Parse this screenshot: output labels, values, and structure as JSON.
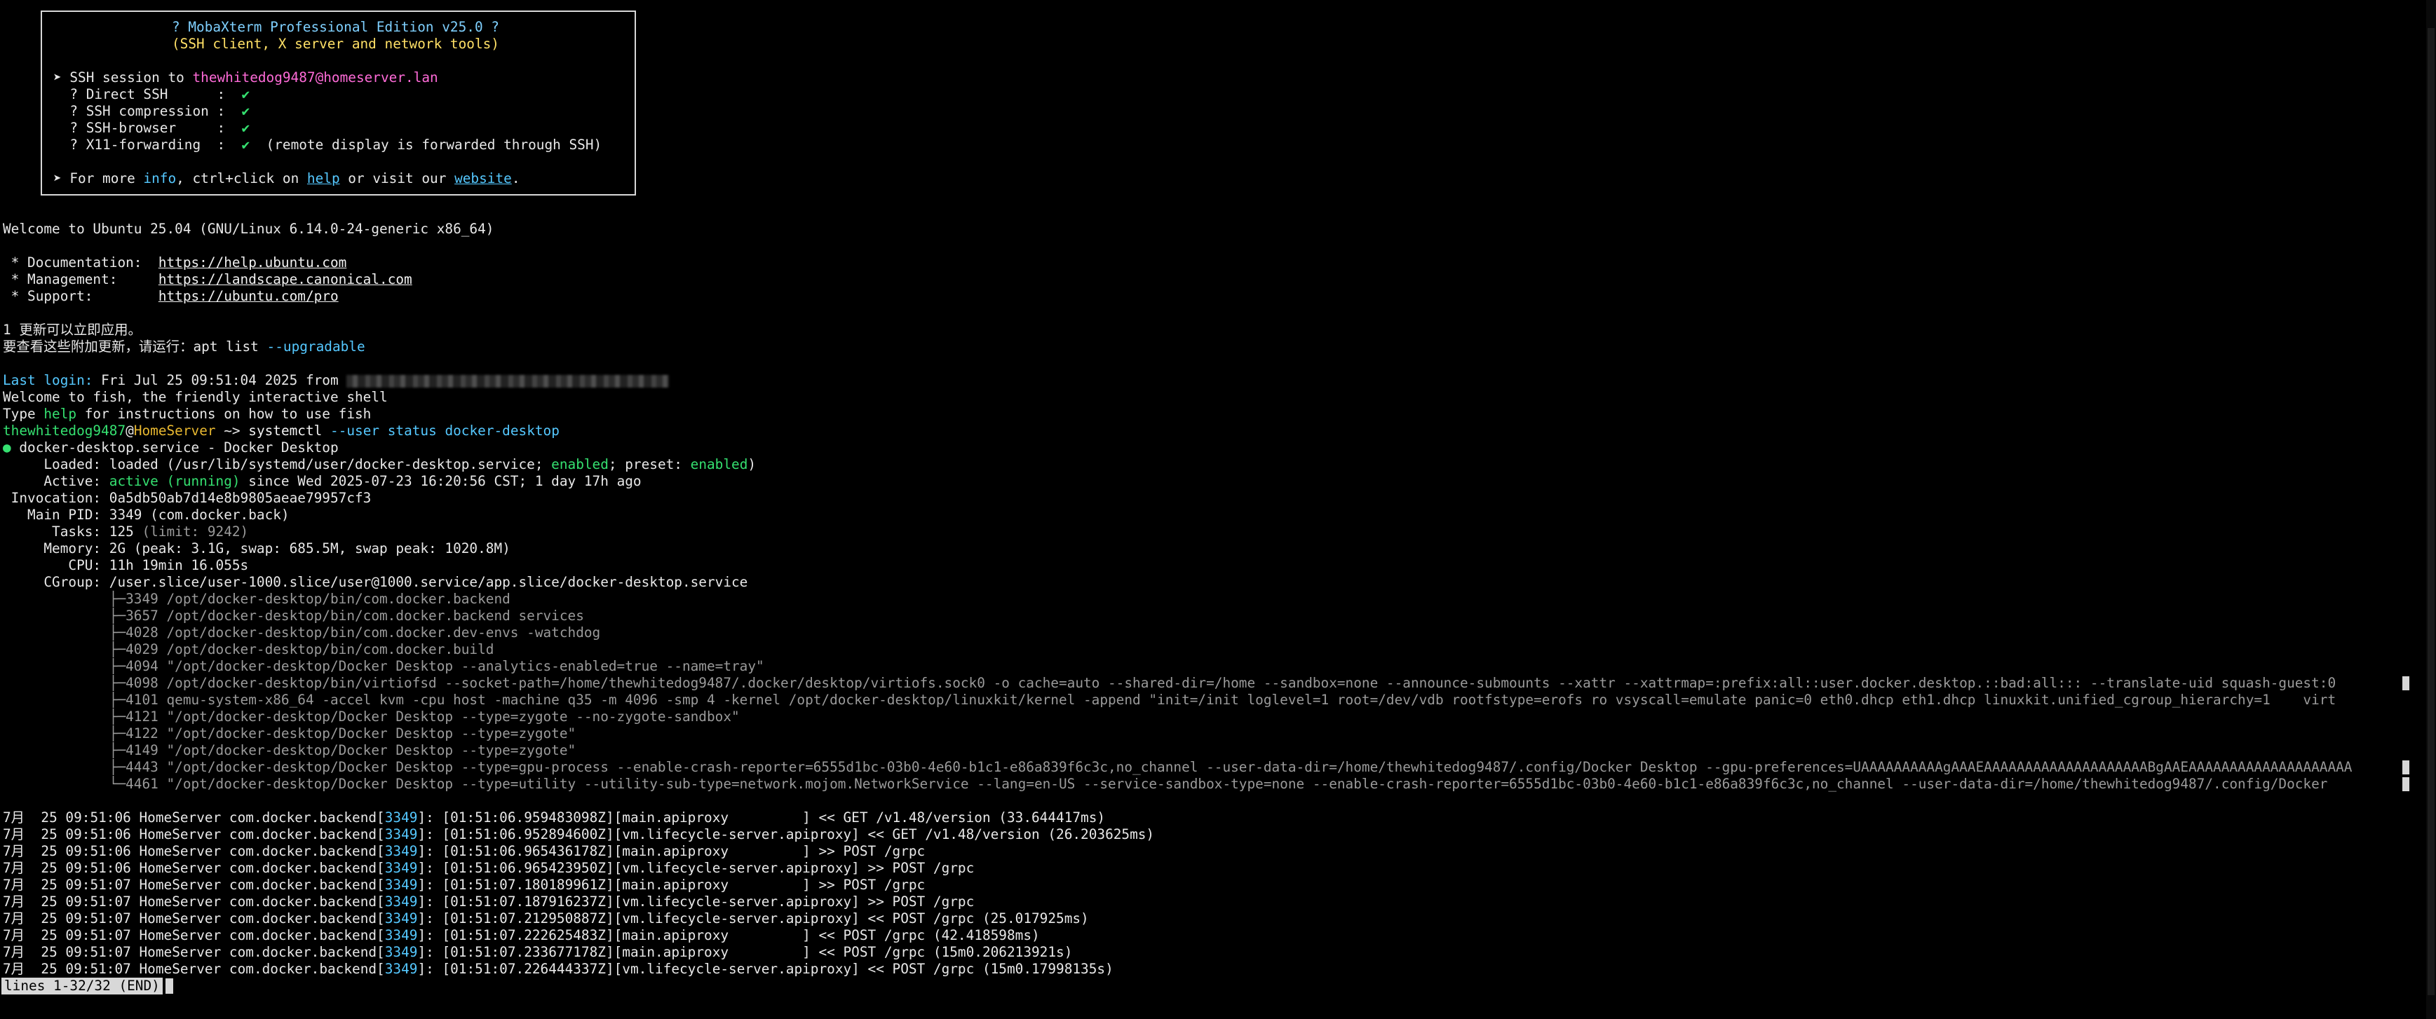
{
  "banner": {
    "title": "? MobaXterm Professional Edition v25.0 ?",
    "subtitle": "(SSH client, X server and network tools)",
    "ssh_prefix": "➤ SSH session to ",
    "ssh_target": "thewhitedog9487@homeserver.lan",
    "features": [
      {
        "label": "  ? Direct SSH      :  ",
        "check": "✔",
        "note": ""
      },
      {
        "label": "  ? SSH compression :  ",
        "check": "✔",
        "note": ""
      },
      {
        "label": "  ? SSH-browser     :  ",
        "check": "✔",
        "note": ""
      },
      {
        "label": "  ? X11-forwarding  :  ",
        "check": "✔",
        "note": "  (remote display is forwarded through SSH)"
      }
    ],
    "more_prefix": "➤ For more ",
    "info_word": "info",
    "more_mid": ", ctrl+click on ",
    "help_link": "help",
    "more_or": " or visit our ",
    "website_link": "website",
    "more_end": "."
  },
  "motd": {
    "welcome": "Welcome to Ubuntu 25.04 (GNU/Linux 6.14.0-24-generic x86_64)",
    "links": [
      {
        "label": " * Documentation:  ",
        "url": "https://help.ubuntu.com"
      },
      {
        "label": " * Management:     ",
        "url": "https://landscape.canonical.com"
      },
      {
        "label": " * Support:        ",
        "url": "https://ubuntu.com/pro"
      }
    ],
    "updates_line": "1 更新可以立即应用。",
    "updates_hint_prefix": "要查看这些附加更新，请运行：apt list ",
    "updates_hint_flag": "--upgradable",
    "last_login_label": "Last login:",
    "last_login_value": " Fri Jul 25 09:51:04 2025 from ",
    "fish_welcome": "Welcome to fish, the friendly interactive shell",
    "fish_help_prefix": "Type ",
    "fish_help_word": "help",
    "fish_help_suffix": " for instructions on how to use fish"
  },
  "prompt": {
    "user": "thewhitedog9487",
    "at": "@",
    "host": "HomeServer",
    "path": " ~> ",
    "command": "systemctl",
    "args": " --user status docker-desktop"
  },
  "status": {
    "bullet": "●",
    "unit_line": " docker-desktop.service - Docker Desktop",
    "loaded_label": "     Loaded: ",
    "loaded_value_a": "loaded (/usr/lib/systemd/user/docker-desktop.service; ",
    "loaded_enabled": "enabled",
    "loaded_value_b": "; preset: ",
    "loaded_preset": "enabled",
    "loaded_close": ")",
    "active_label": "     Active: ",
    "active_value": "active (running)",
    "active_rest": " since Wed 2025-07-23 16:20:56 CST; 1 day 17h ago",
    "invocation_label": " Invocation: ",
    "invocation_value": "0a5db50ab7d14e8b9805aeae79957cf3",
    "mainpid_label": "   Main PID: ",
    "mainpid_value": "3349 (com.docker.back)",
    "tasks_label": "      Tasks: ",
    "tasks_value": "125",
    "tasks_limit": " (limit: 9242)",
    "memory_label": "     Memory: ",
    "memory_value": "2G (peak: 3.1G, swap: 685.5M, swap peak: 1020.8M)",
    "cpu_label": "        CPU: ",
    "cpu_value": "11h 19min 16.055s",
    "cgroup_label": "     CGroup: ",
    "cgroup_value": "/user.slice/user-1000.slice/user@1000.service/app.slice/docker-desktop.service",
    "processes": [
      "             ├─3349 /opt/docker-desktop/bin/com.docker.backend",
      "             ├─3657 /opt/docker-desktop/bin/com.docker.backend services",
      "             ├─4028 /opt/docker-desktop/bin/com.docker.dev-envs -watchdog",
      "             ├─4029 /opt/docker-desktop/bin/com.docker.build",
      "             ├─4094 \"/opt/docker-desktop/Docker Desktop --analytics-enabled=true --name=tray\"",
      "             ├─4098 /opt/docker-desktop/bin/virtiofsd --socket-path=/home/thewhitedog9487/.docker/desktop/virtiofs.sock0 -o cache=auto --shared-dir=/home --sandbox=none --announce-submounts --xattr --xattrmap=:prefix:all::user.docker.desktop.::bad:all::: --translate-uid squash-guest:0",
      "             ├─4101 qemu-system-x86_64 -accel kvm -cpu host -machine q35 -m 4096 -smp 4 -kernel /opt/docker-desktop/linuxkit/kernel -append \"init=/init loglevel=1 root=/dev/vdb rootfstype=erofs ro vsyscall=emulate panic=0 eth0.dhcp eth1.dhcp linuxkit.unified_cgroup_hierarchy=1    virt",
      "             ├─4121 \"/opt/docker-desktop/Docker Desktop --type=zygote --no-zygote-sandbox\"",
      "             ├─4122 \"/opt/docker-desktop/Docker Desktop --type=zygote\"",
      "             ├─4149 \"/opt/docker-desktop/Docker Desktop --type=zygote\"",
      "             ├─4443 \"/opt/docker-desktop/Docker Desktop --type=gpu-process --enable-crash-reporter=6555d1bc-03b0-4e60-b1c1-e86a839f6c3c,no_channel --user-data-dir=/home/thewhitedog9487/.config/Docker Desktop --gpu-preferences=UAAAAAAAAAAgAAAEAAAAAAAAAAAAAAAAAAAABgAAEAAAAAAAAAAAAAAAAAAAA",
      "             └─4461 \"/opt/docker-desktop/Docker Desktop --type=utility --utility-sub-type=network.mojom.NetworkService --lang=en-US --service-sandbox-type=none --enable-crash-reporter=6555d1bc-03b0-4e60-b1c1-e86a839f6c3c,no_channel --user-data-dir=/home/thewhitedog9487/.config/Docker"
    ]
  },
  "log": {
    "entries": [
      {
        "prefix": "7月  25 09:51:06 HomeServer com.docker.backend[",
        "pid": "3349",
        "msg": "]: [01:51:06.959483098Z][main.apiproxy         ] << GET /v1.48/version (33.644417ms)"
      },
      {
        "prefix": "7月  25 09:51:06 HomeServer com.docker.backend[",
        "pid": "3349",
        "msg": "]: [01:51:06.952894600Z][vm.lifecycle-server.apiproxy] << GET /v1.48/version (26.203625ms)"
      },
      {
        "prefix": "7月  25 09:51:06 HomeServer com.docker.backend[",
        "pid": "3349",
        "msg": "]: [01:51:06.965436178Z][main.apiproxy         ] >> POST /grpc"
      },
      {
        "prefix": "7月  25 09:51:06 HomeServer com.docker.backend[",
        "pid": "3349",
        "msg": "]: [01:51:06.965423950Z][vm.lifecycle-server.apiproxy] >> POST /grpc"
      },
      {
        "prefix": "7月  25 09:51:07 HomeServer com.docker.backend[",
        "pid": "3349",
        "msg": "]: [01:51:07.180189961Z][main.apiproxy         ] >> POST /grpc"
      },
      {
        "prefix": "7月  25 09:51:07 HomeServer com.docker.backend[",
        "pid": "3349",
        "msg": "]: [01:51:07.187916237Z][vm.lifecycle-server.apiproxy] >> POST /grpc"
      },
      {
        "prefix": "7月  25 09:51:07 HomeServer com.docker.backend[",
        "pid": "3349",
        "msg": "]: [01:51:07.212950887Z][vm.lifecycle-server.apiproxy] << POST /grpc (25.017925ms)"
      },
      {
        "prefix": "7月  25 09:51:07 HomeServer com.docker.backend[",
        "pid": "3349",
        "msg": "]: [01:51:07.222625483Z][main.apiproxy         ] << POST /grpc (42.418598ms)"
      },
      {
        "prefix": "7月  25 09:51:07 HomeServer com.docker.backend[",
        "pid": "3349",
        "msg": "]: [01:51:07.233677178Z][main.apiproxy         ] << POST /grpc (15m0.206213921s)"
      },
      {
        "prefix": "7月  25 09:51:07 HomeServer com.docker.backend[",
        "pid": "3349",
        "msg": "]: [01:51:07.226444337Z][vm.lifecycle-server.apiproxy] << POST /grpc (15m0.17998135s)"
      }
    ]
  },
  "pager": {
    "status": "lines 1-32/32 (END)"
  },
  "colors": {
    "background": "#000000",
    "foreground": "#e8e8e8",
    "green": "#35e070",
    "cyan": "#55c8ff",
    "magenta": "#ff6bd8",
    "yellow": "#ffe066"
  }
}
